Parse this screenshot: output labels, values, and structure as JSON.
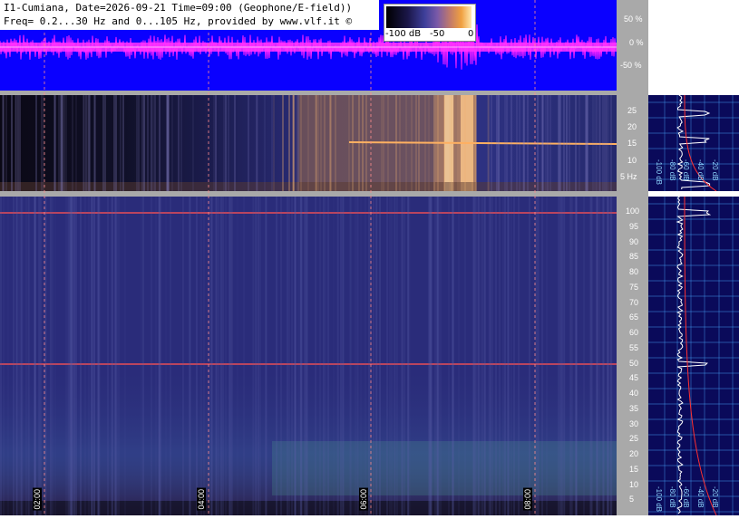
{
  "header": {
    "line1": "I1-Cumiana, Date=2026-09-21 Time=09:00 (Geophone/E-field))",
    "line2": "Freq= 0.2...30 Hz and 0...105 Hz, provided by www.vlf.it ©"
  },
  "colorbar": {
    "min_label": "-100 dB",
    "mid_label": "-50",
    "max_label": "0"
  },
  "waveform_axis": [
    "50 %",
    "0 %",
    "-50 %"
  ],
  "elf_axis": [
    "25",
    "20",
    "15",
    "10",
    "5 Hz"
  ],
  "ulf_axis": [
    "100",
    "95",
    "90",
    "85",
    "80",
    "75",
    "70",
    "65",
    "60",
    "55",
    "50",
    "45",
    "40",
    "35",
    "30",
    "25",
    "20",
    "15",
    "10",
    "5"
  ],
  "spectrum_labels": [
    "-100 dB",
    "-80 dB",
    "-60 dB",
    "-40 dB",
    "-20 dB"
  ],
  "time_labels": [
    "02:00",
    "04:00",
    "06:00",
    "08:00"
  ],
  "colors": {
    "waveform_bg": "#0a00ff",
    "waveform_trace": "#ff22ff",
    "spectro_bg": "#2a2c7a",
    "axis_gray": "#a9a9a9",
    "grid_blue": "#4aa8ff"
  }
}
